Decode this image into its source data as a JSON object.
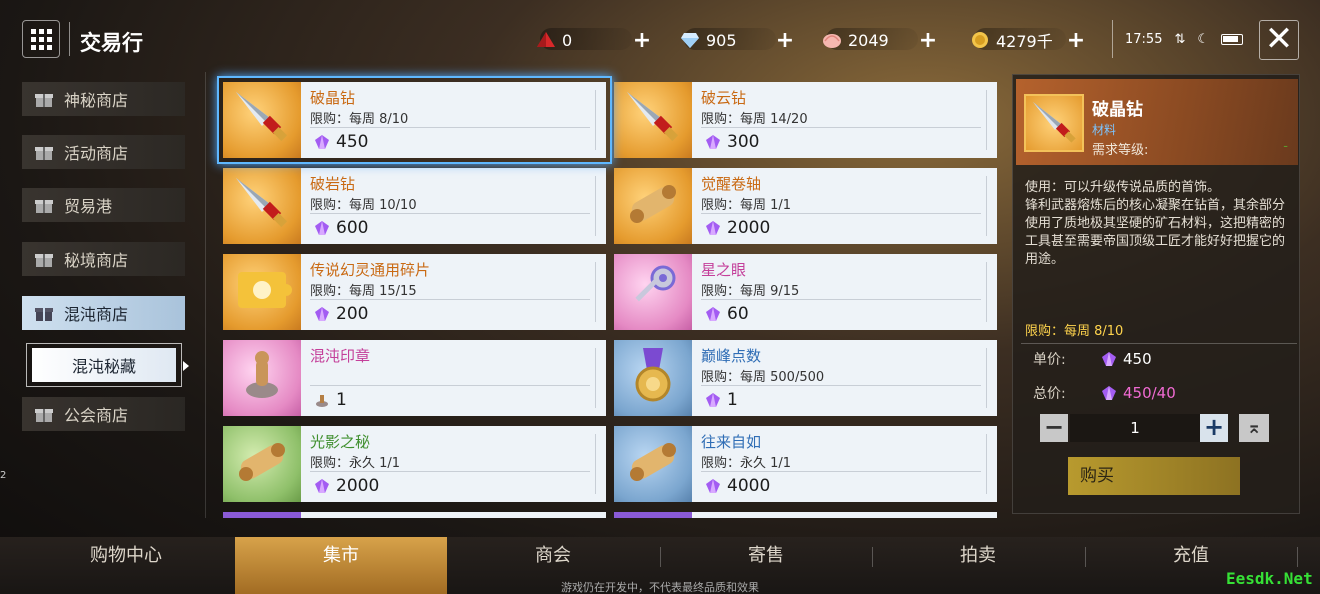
{
  "header": {
    "title": "交易行",
    "currencies": [
      {
        "icon": "red-crystal-icon",
        "value": "0"
      },
      {
        "icon": "diamond-icon",
        "value": "905"
      },
      {
        "icon": "shell-icon",
        "value": "2049"
      },
      {
        "icon": "gold-coin-icon",
        "value": "4279千"
      }
    ],
    "time": "17:55"
  },
  "sidebar": {
    "items": [
      {
        "label": "神秘商店"
      },
      {
        "label": "活动商店"
      },
      {
        "label": "贸易港"
      },
      {
        "label": "秘境商店"
      },
      {
        "label": "混沌商店"
      },
      {
        "label": "公会商店"
      }
    ],
    "sub_item": "混沌秘藏"
  },
  "items": [
    {
      "name": "破晶钻",
      "limit": "限购：每周 8/10",
      "price": "450",
      "color": "orange",
      "thumb": "orange",
      "icon": "drill-icon",
      "currency": "gem"
    },
    {
      "name": "破云钻",
      "limit": "限购：每周 14/20",
      "price": "300",
      "color": "orange",
      "thumb": "orange",
      "icon": "drill-icon",
      "currency": "gem"
    },
    {
      "name": "破岩钻",
      "limit": "限购：每周 10/10",
      "price": "600",
      "color": "orange",
      "thumb": "orange",
      "icon": "drill-icon",
      "currency": "gem"
    },
    {
      "name": "觉醒卷轴",
      "limit": "限购：每周 1/1",
      "price": "2000",
      "color": "orange",
      "thumb": "orange",
      "icon": "scroll-icon",
      "currency": "gem"
    },
    {
      "name": "传说幻灵通用碎片",
      "limit": "限购：每周 15/15",
      "price": "200",
      "color": "orange",
      "thumb": "orange",
      "icon": "puzzle-icon",
      "currency": "gem"
    },
    {
      "name": "星之眼",
      "limit": "限购：每周 9/15",
      "price": "60",
      "color": "pink",
      "thumb": "pink",
      "icon": "key-icon",
      "currency": "gem"
    },
    {
      "name": "混沌印章",
      "limit": "",
      "price": "1",
      "color": "pink",
      "thumb": "pink",
      "icon": "seal-icon",
      "currency": "seal"
    },
    {
      "name": "巅峰点数",
      "limit": "限购：每周 500/500",
      "price": "1",
      "color": "blue",
      "thumb": "blue",
      "icon": "medal-icon",
      "currency": "gem"
    },
    {
      "name": "光影之秘",
      "limit": "限购：永久 1/1",
      "price": "2000",
      "color": "green",
      "thumb": "green",
      "icon": "scroll-icon",
      "currency": "gem"
    },
    {
      "name": "往来自如",
      "limit": "限购：永久 1/1",
      "price": "4000",
      "color": "blue",
      "thumb": "blue",
      "icon": "scroll-icon",
      "currency": "gem"
    }
  ],
  "detail": {
    "name": "破晶钻",
    "type": "材料",
    "level_label": "需求等级:",
    "level_value": "-",
    "description": "使用：可以升级传说品质的首饰。\n锋利武器熔炼后的核心凝聚在钻首，其余部分使用了质地极其坚硬的矿石材料，这把精密的工具甚至需要帝国顶级工匠才能好好把握它的用途。",
    "limit": "限购：每周 8/10",
    "unit_price_label": "单价:",
    "unit_price": "450",
    "total_price_label": "总价:",
    "total_price": "450/40",
    "quantity": "1",
    "buy_label": "购买"
  },
  "bottom_nav": {
    "tabs": [
      "购物中心",
      "集市",
      "商会",
      "寄售",
      "拍卖",
      "充值"
    ],
    "active": "集市",
    "dev_note": "游戏仍在开发中，不代表最终品质和效果"
  },
  "watermark": "Eesdk.Net",
  "edge_mark": "2"
}
